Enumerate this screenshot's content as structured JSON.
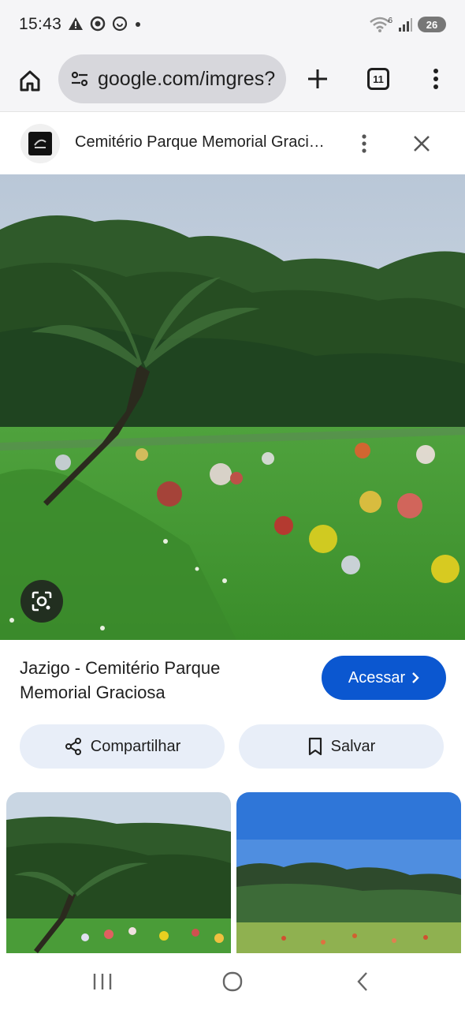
{
  "status_bar": {
    "time": "15:43",
    "network_label": "6",
    "battery_level": "26"
  },
  "browser": {
    "url": "google.com/imgres?",
    "tab_count": "11"
  },
  "site": {
    "title": "Cemitério Parque Memorial Graciosa"
  },
  "result": {
    "title": "Jazigo - Cemitério Parque Memorial Graciosa",
    "access_label": "Acessar",
    "share_label": "Compartilhar",
    "save_label": "Salvar"
  },
  "colors": {
    "accent": "#0b57d0",
    "chip_bg": "#e8eef8"
  }
}
